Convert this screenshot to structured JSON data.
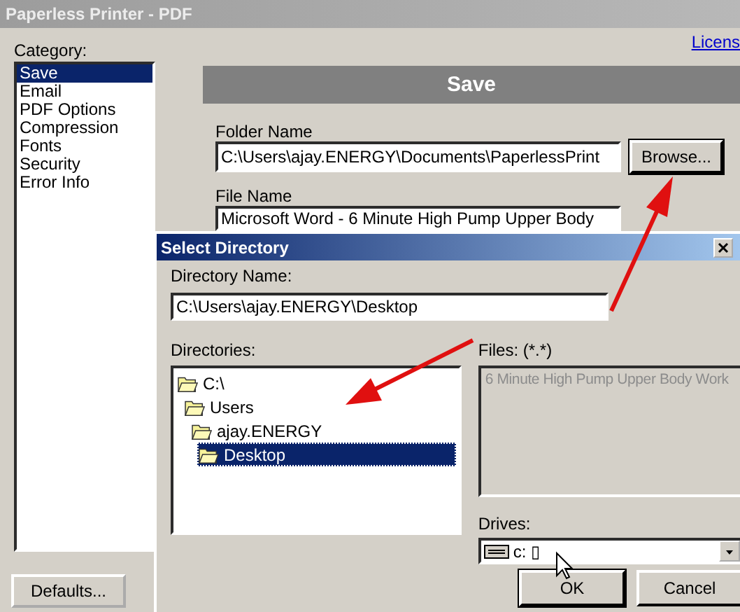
{
  "window": {
    "title": "Paperless Printer - PDF"
  },
  "sidebar": {
    "label": "Category:",
    "items": [
      {
        "label": "Save",
        "selected": true
      },
      {
        "label": "Email",
        "selected": false
      },
      {
        "label": "PDF Options",
        "selected": false
      },
      {
        "label": "Compression",
        "selected": false
      },
      {
        "label": "Fonts",
        "selected": false
      },
      {
        "label": "Security",
        "selected": false
      },
      {
        "label": "Error Info",
        "selected": false
      }
    ]
  },
  "license_link": "Licens",
  "panel": {
    "header": "Save",
    "folder_name": {
      "label": "Folder Name",
      "value": "C:\\Users\\ajay.ENERGY\\Documents\\PaperlessPrint"
    },
    "browse_button": "Browse...",
    "file_name": {
      "label": "File Name",
      "value": "Microsoft Word - 6 Minute High Pump Upper Body"
    }
  },
  "defaults_button": "Defaults...",
  "dialog": {
    "title": "Select Directory",
    "directory_name": {
      "label": "Directory Name:",
      "value": "C:\\Users\\ajay.ENERGY\\Desktop"
    },
    "directories": {
      "label": "Directories:",
      "items": [
        {
          "label": "C:\\",
          "selected": false,
          "children": [
            {
              "label": "Users",
              "selected": false,
              "children": [
                {
                  "label": "ajay.ENERGY",
                  "selected": false,
                  "children": [
                    {
                      "label": "Desktop",
                      "selected": true
                    }
                  ]
                }
              ]
            }
          ]
        }
      ]
    },
    "files": {
      "label": "Files: (*.*)",
      "items": [
        {
          "label": "6 Minute High Pump Upper Body Work",
          "disabled": true
        }
      ]
    },
    "drives": {
      "label": "Drives:",
      "value": "c: ▯"
    },
    "buttons": [
      {
        "label": "OK",
        "default": true
      },
      {
        "label": "Cancel",
        "default": false
      }
    ]
  }
}
